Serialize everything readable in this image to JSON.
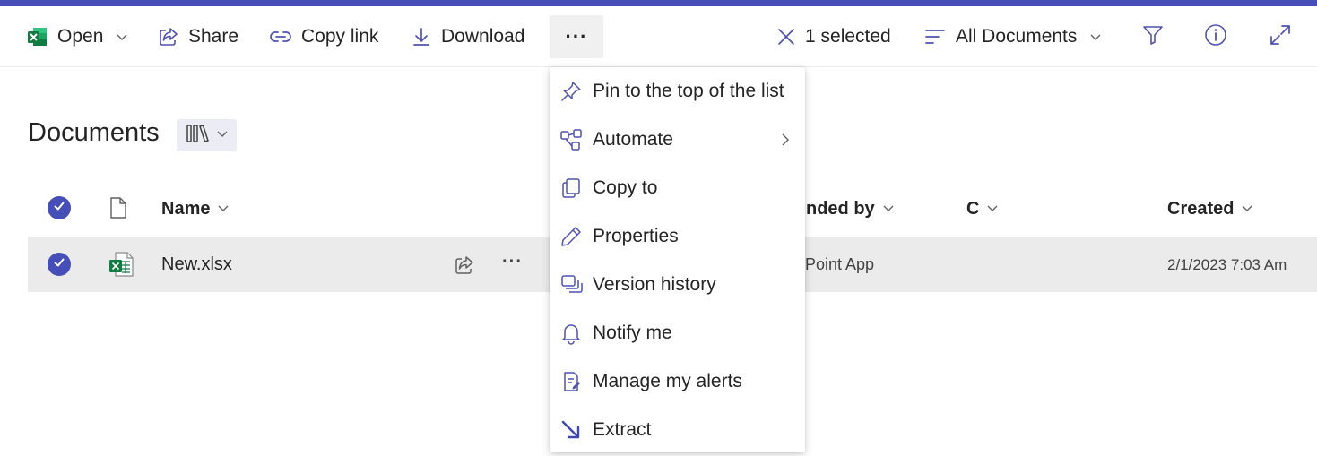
{
  "colors": {
    "accent": "#464eb8",
    "excel_green": "#107c41",
    "icon_blue": "#4f52b2"
  },
  "command_bar": {
    "open_label": "Open",
    "share_label": "Share",
    "copy_link_label": "Copy link",
    "download_label": "Download",
    "more_label": "···",
    "selection_label": "1 selected",
    "view_label": "All Documents"
  },
  "library": {
    "title": "Documents"
  },
  "columns": {
    "name": "Name",
    "amended_by": "nded by",
    "c": "C",
    "created": "Created"
  },
  "rows": [
    {
      "name": "New.xlsx",
      "modified_by": "Point App",
      "created": "2/1/2023 7:03 Am",
      "selected": true
    }
  ],
  "context_menu": {
    "items": [
      {
        "label": "Pin to the top of the list",
        "icon": "pin-icon"
      },
      {
        "label": "Automate",
        "icon": "automate-icon",
        "submenu": true
      },
      {
        "label": "Copy to",
        "icon": "copy-icon"
      },
      {
        "label": "Properties",
        "icon": "pencil-icon"
      },
      {
        "label": "Version history",
        "icon": "version-history-icon"
      },
      {
        "label": "Notify me",
        "icon": "bell-icon"
      },
      {
        "label": "Manage my alerts",
        "icon": "alerts-icon"
      },
      {
        "label": "Extract",
        "icon": "extract-arrow-icon"
      }
    ]
  }
}
